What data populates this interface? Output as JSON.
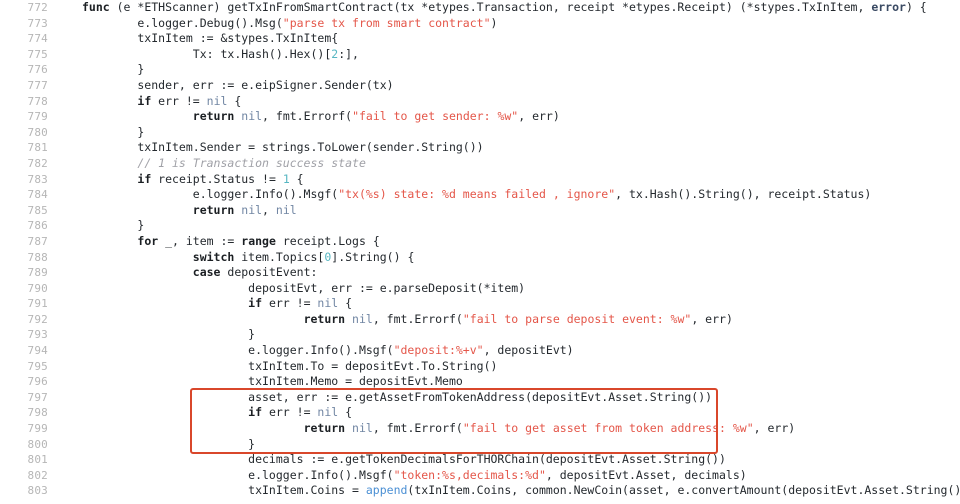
{
  "viewer": {
    "title": "getTxInFromSmartContract",
    "language": "go",
    "first_line_number": 772,
    "gutter_color": "#b6b6b6",
    "background": "#ffffff",
    "text_color": "#24292e"
  },
  "annotation": {
    "type": "rectangle-highlight",
    "color": "#d9472b",
    "covers_lines": "797-800",
    "label": ""
  },
  "colors": {
    "keyword": "#1b1f23",
    "string": "#e45649",
    "comment": "#a0a1a7",
    "number": "#56b6c2",
    "nil": "#7186a3",
    "builtin": "#4a8fd4",
    "error_type": "#3a4a63"
  },
  "lines": [
    {
      "n": "772",
      "html": "<span class=\"kw\">func</span> (e *ETHScanner) getTxInFromSmartContract(tx *etypes.Transaction, receipt *etypes.Receipt) (*stypes.TxInItem, <span class=\"err\">error</span>) {"
    },
    {
      "n": "773",
      "html": "        e.logger.Debug().Msg(<span class=\"str\">\"parse tx from smart contract\"</span>)"
    },
    {
      "n": "774",
      "html": "        txInItem := &amp;stypes.TxInItem{"
    },
    {
      "n": "775",
      "html": "                Tx: tx.Hash().Hex()[<span class=\"num\">2</span>:],"
    },
    {
      "n": "776",
      "html": "        }"
    },
    {
      "n": "777",
      "html": "        sender, err := e.eipSigner.Sender(tx)"
    },
    {
      "n": "778",
      "html": "        <span class=\"kw\">if</span> err != <span class=\"nil\">nil</span> {"
    },
    {
      "n": "779",
      "html": "                <span class=\"kw\">return</span> <span class=\"nil\">nil</span>, fmt.Errorf(<span class=\"str\">\"fail to get sender: %w\"</span>, err)"
    },
    {
      "n": "780",
      "html": "        }"
    },
    {
      "n": "781",
      "html": "        txInItem.Sender = strings.ToLower(sender.String())"
    },
    {
      "n": "782",
      "html": "        <span class=\"cmt\">// 1 is Transaction success state</span>"
    },
    {
      "n": "783",
      "html": "        <span class=\"kw\">if</span> receipt.Status != <span class=\"num\">1</span> {"
    },
    {
      "n": "784",
      "html": "                e.logger.Info().Msgf(<span class=\"str\">\"tx(%s) state: %d means failed , ignore\"</span>, tx.Hash().String(), receipt.Status)"
    },
    {
      "n": "785",
      "html": "                <span class=\"kw\">return</span> <span class=\"nil\">nil</span>, <span class=\"nil\">nil</span>"
    },
    {
      "n": "786",
      "html": "        }"
    },
    {
      "n": "787",
      "html": "        <span class=\"kw\">for</span> _, item := <span class=\"kw\">range</span> receipt.Logs {"
    },
    {
      "n": "788",
      "html": "                <span class=\"kw\">switch</span> item.Topics[<span class=\"num\">0</span>].String() {"
    },
    {
      "n": "789",
      "html": "                <span class=\"kw\">case</span> depositEvent:"
    },
    {
      "n": "790",
      "html": "                        depositEvt, err := e.parseDeposit(*item)"
    },
    {
      "n": "791",
      "html": "                        <span class=\"kw\">if</span> err != <span class=\"nil\">nil</span> {"
    },
    {
      "n": "792",
      "html": "                                <span class=\"kw\">return</span> <span class=\"nil\">nil</span>, fmt.Errorf(<span class=\"str\">\"fail to parse deposit event: %w\"</span>, err)"
    },
    {
      "n": "793",
      "html": "                        }"
    },
    {
      "n": "794",
      "html": "                        e.logger.Info().Msgf(<span class=\"str\">\"deposit:%+v\"</span>, depositEvt)"
    },
    {
      "n": "795",
      "html": "                        txInItem.To = depositEvt.To.String()"
    },
    {
      "n": "796",
      "html": "                        txInItem.Memo = depositEvt.Memo"
    },
    {
      "n": "797",
      "html": "                        asset, err := e.getAssetFromTokenAddress(depositEvt.Asset.String())"
    },
    {
      "n": "798",
      "html": "                        <span class=\"kw\">if</span> err != <span class=\"nil\">nil</span> {"
    },
    {
      "n": "799",
      "html": "                                <span class=\"kw\">return</span> <span class=\"nil\">nil</span>, fmt.Errorf(<span class=\"str\">\"fail to get asset from token address: %w\"</span>, err)"
    },
    {
      "n": "800",
      "html": "                        }"
    },
    {
      "n": "801",
      "html": "                        decimals := e.getTokenDecimalsForTHORChain(depositEvt.Asset.String())"
    },
    {
      "n": "802",
      "html": "                        e.logger.Info().Msgf(<span class=\"str\">\"token:%s,decimals:%d\"</span>, depositEvt.Asset, decimals)"
    },
    {
      "n": "803",
      "html": "                        txInItem.Coins = <span class=\"bi\">append</span>(txInItem.Coins, common.NewCoin(asset, e.convertAmount(depositEvt.Asset.String(), depositEvt.A"
    }
  ]
}
